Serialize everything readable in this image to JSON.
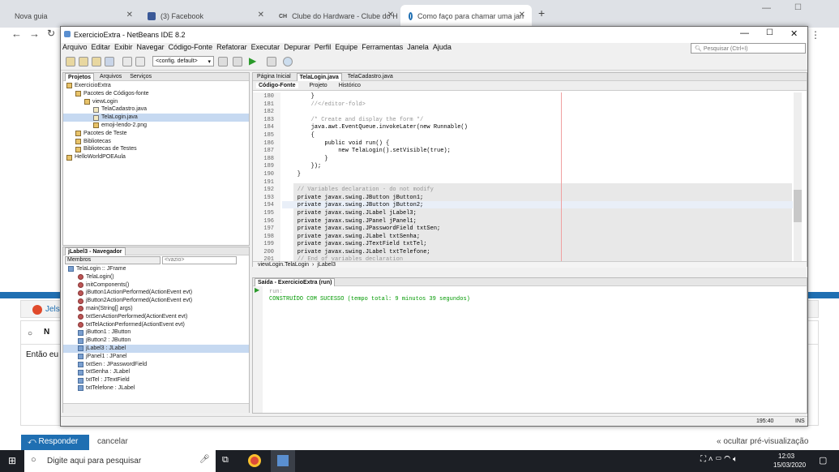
{
  "browser": {
    "tabs": [
      {
        "label": "Nova guia"
      },
      {
        "label": "(3) Facebook"
      },
      {
        "label": "Clube do Hardware - Clube do H"
      },
      {
        "label": "Como faço para chamar uma jan"
      }
    ],
    "new_tab": "+"
  },
  "page": {
    "author": "Jels",
    "draft_n": "N",
    "draft_text": "Então eu",
    "reply_button": "Responder",
    "cancel": "cancelar",
    "hide_preview": "« ocultar pré-visualização"
  },
  "netbeans": {
    "title": "ExercicioExtra - NetBeans IDE 8.2",
    "menu": [
      "Arquivo",
      "Editar",
      "Exibir",
      "Navegar",
      "Código-Fonte",
      "Refatorar",
      "Executar",
      "Depurar",
      "Perfil",
      "Equipe",
      "Ferramentas",
      "Janela",
      "Ajuda"
    ],
    "search_placeholder": "Pesquisar (Ctrl+I)",
    "config": "<config. default>",
    "project_tabs": [
      "Projetos",
      "Arquivos",
      "Serviços"
    ],
    "project_tree": [
      {
        "label": "ExercicioExtra",
        "depth": 0,
        "icon": "project"
      },
      {
        "label": "Pacotes de Códigos-fonte",
        "depth": 1,
        "icon": "folder"
      },
      {
        "label": "viewLogin",
        "depth": 2,
        "icon": "package"
      },
      {
        "label": "TelaCadastro.java",
        "depth": 3,
        "icon": "java"
      },
      {
        "label": "TelaLogin.java",
        "depth": 3,
        "icon": "java",
        "selected": true
      },
      {
        "label": "emoji-lendo-2.png",
        "depth": 3,
        "icon": "image"
      },
      {
        "label": "Pacotes de Teste",
        "depth": 1,
        "icon": "folder"
      },
      {
        "label": "Bibliotecas",
        "depth": 1,
        "icon": "folder"
      },
      {
        "label": "Bibliotecas de Testes",
        "depth": 1,
        "icon": "folder"
      },
      {
        "label": "HelloWorldPOEAula",
        "depth": 0,
        "icon": "project"
      }
    ],
    "navigator": {
      "title": "jLabel3 - Navegador",
      "filter": "Membros",
      "filter2": "<vazio>",
      "items": [
        {
          "label": "TelaLogin :: JFrame",
          "depth": 0
        },
        {
          "label": "TelaLogin()",
          "depth": 1
        },
        {
          "label": "initComponents()",
          "depth": 1
        },
        {
          "label": "jButton1ActionPerformed(ActionEvent evt)",
          "depth": 1
        },
        {
          "label": "jButton2ActionPerformed(ActionEvent evt)",
          "depth": 1
        },
        {
          "label": "main(String[] args)",
          "depth": 1
        },
        {
          "label": "txtSenActionPerformed(ActionEvent evt)",
          "depth": 1
        },
        {
          "label": "txtTelActionPerformed(ActionEvent evt)",
          "depth": 1
        },
        {
          "label": "jButton1 : JButton",
          "depth": 1
        },
        {
          "label": "jButton2 : JButton",
          "depth": 1
        },
        {
          "label": "jLabel3 : JLabel",
          "depth": 1,
          "selected": true
        },
        {
          "label": "jPanel1 : JPanel",
          "depth": 1
        },
        {
          "label": "txtSen : JPasswordField",
          "depth": 1
        },
        {
          "label": "txtSenha : JLabel",
          "depth": 1
        },
        {
          "label": "txtTel : JTextField",
          "depth": 1
        },
        {
          "label": "txtTelefone : JLabel",
          "depth": 1
        }
      ]
    },
    "editor_tabs": [
      "Página Inicial",
      "TelaLogin.java",
      "TelaCadastro.java"
    ],
    "editor_subtabs": [
      "Código-Fonte",
      "Projeto",
      "Histórico"
    ],
    "code_lines": [
      {
        "n": "180",
        "t": "        }"
      },
      {
        "n": "181",
        "t": "        //</editor-fold>"
      },
      {
        "n": "182",
        "t": ""
      },
      {
        "n": "183",
        "t": "        /* Create and display the form */"
      },
      {
        "n": "184",
        "t": "        java.awt.EventQueue.invokeLater(new Runnable()"
      },
      {
        "n": "185",
        "t": "        {"
      },
      {
        "n": "186",
        "t": "            public void run() {"
      },
      {
        "n": "187",
        "t": "                new TelaLogin().setVisible(true);"
      },
      {
        "n": "188",
        "t": "            }"
      },
      {
        "n": "189",
        "t": "        });"
      },
      {
        "n": "190",
        "t": "    }"
      },
      {
        "n": "191",
        "t": ""
      },
      {
        "n": "192",
        "t": "    // Variables declaration - do not modify"
      },
      {
        "n": "193",
        "t": "    private javax.swing.JButton jButton1;"
      },
      {
        "n": "194",
        "t": "    private javax.swing.JButton jButton2;"
      },
      {
        "n": "195",
        "t": "    private javax.swing.JLabel jLabel3;"
      },
      {
        "n": "196",
        "t": "    private javax.swing.JPanel jPanel1;"
      },
      {
        "n": "197",
        "t": "    private javax.swing.JPasswordField txtSen;"
      },
      {
        "n": "198",
        "t": "    private javax.swing.JLabel txtSenha;"
      },
      {
        "n": "199",
        "t": "    private javax.swing.JTextField txtTel;"
      },
      {
        "n": "200",
        "t": "    private javax.swing.JLabel txtTelefone;"
      },
      {
        "n": "201",
        "t": "    // End of variables declaration"
      }
    ],
    "breadcrumb": [
      "viewLogin.TelaLogin",
      "jLabel3"
    ],
    "output_title": "Saída - ExercicioExtra (run)",
    "output_lines": [
      "run:",
      "CONSTRUÍDO COM SUCESSO (tempo total: 9 minutos 39 segundos)"
    ],
    "status_pos": "195:40",
    "status_mode": "INS"
  },
  "taskbar": {
    "search": "Digite aqui para pesquisar",
    "time": "12:03",
    "date": "15/03/2020"
  }
}
